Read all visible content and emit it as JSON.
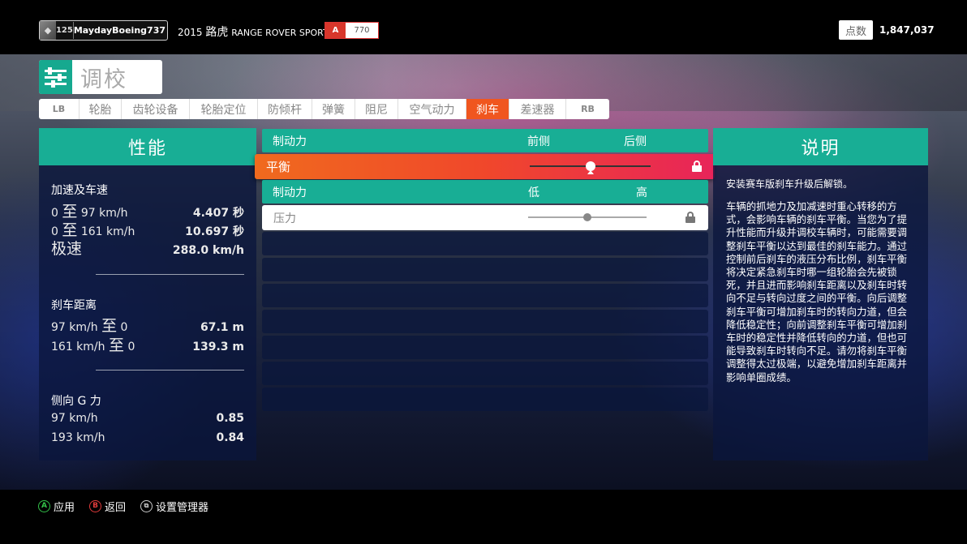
{
  "topbar": {
    "level": "125",
    "gamertag": "MaydayBoeing737",
    "car_year": "2015",
    "car_make": "路虎",
    "car_model": "RANGE ROVER SPORT SVR",
    "pi_class": "A",
    "pi_value": "770",
    "credits_label": "点数",
    "credits_value": "1,847,037"
  },
  "title": "调校",
  "tabs": [
    {
      "label": "LB",
      "active": false
    },
    {
      "label": "轮胎",
      "active": false
    },
    {
      "label": "齿轮设备",
      "active": false
    },
    {
      "label": "轮胎定位",
      "active": false
    },
    {
      "label": "防倾杆",
      "active": false
    },
    {
      "label": "弹簧",
      "active": false
    },
    {
      "label": "阻尼",
      "active": false
    },
    {
      "label": "空气动力",
      "active": false
    },
    {
      "label": "刹车",
      "active": true
    },
    {
      "label": "差速器",
      "active": false
    },
    {
      "label": "RB",
      "active": false
    }
  ],
  "performance": {
    "header": "性能",
    "accel_title": "加速及车速",
    "accel_rows": [
      {
        "from": "0",
        "sep": "至",
        "to": "97 km/h",
        "value": "4.407 秒"
      },
      {
        "from": "0",
        "sep": "至",
        "to": "161 km/h",
        "value": "10.697 秒"
      }
    ],
    "top_speed_label": "极速",
    "top_speed_value": "288.0 km/h",
    "braking_title": "刹车距离",
    "braking_rows": [
      {
        "from": "97 km/h",
        "sep": "至",
        "to": "0",
        "value": "67.1 m"
      },
      {
        "from": "161 km/h",
        "sep": "至",
        "to": "0",
        "value": "139.3 m"
      }
    ],
    "lateral_title": "侧向 G 力",
    "lateral_rows": [
      {
        "label": "97 km/h",
        "value": "0.85"
      },
      {
        "label": "193 km/h",
        "value": "0.84"
      }
    ]
  },
  "tuning": {
    "group1": {
      "name": "制动力",
      "col1": "前侧",
      "col2": "后侧"
    },
    "balance": {
      "name": "平衡",
      "value": 0.5,
      "locked": true
    },
    "group2": {
      "name": "制动力",
      "col1": "低",
      "col2": "高"
    },
    "pressure": {
      "name": "压力",
      "value": 0.5,
      "locked": true
    }
  },
  "description": {
    "header": "说明",
    "intro": "安装赛车版刹车升级后解锁。",
    "body": "车辆的抓地力及加减速时重心转移的方式，会影响车辆的刹车平衡。当您为了提升性能而升级并调校车辆时，可能需要调整刹车平衡以达到最佳的刹车能力。通过控制前后刹车的液压分布比例，刹车平衡将决定紧急刹车时哪一组轮胎会先被锁死，并且进而影响刹车距离以及刹车时转向不足与转向过度之间的平衡。向后调整刹车平衡可增加刹车时的转向力道，但会降低稳定性；向前调整刹车平衡可增加刹车时的稳定性并降低转向的力道，但也可能导致刹车时转向不足。请勿将刹车平衡调整得太过极端，以避免增加刹车距离并影响单圈成绩。"
  },
  "footer": {
    "apply": {
      "glyph": "A",
      "label": "应用"
    },
    "back": {
      "glyph": "B",
      "label": "返回"
    },
    "manager": {
      "glyph": "⧉",
      "label": "设置管理器"
    }
  },
  "colors": {
    "accent_teal": "#18ae95",
    "active_orange": "#f0561f",
    "pi_red": "#d8362b"
  }
}
